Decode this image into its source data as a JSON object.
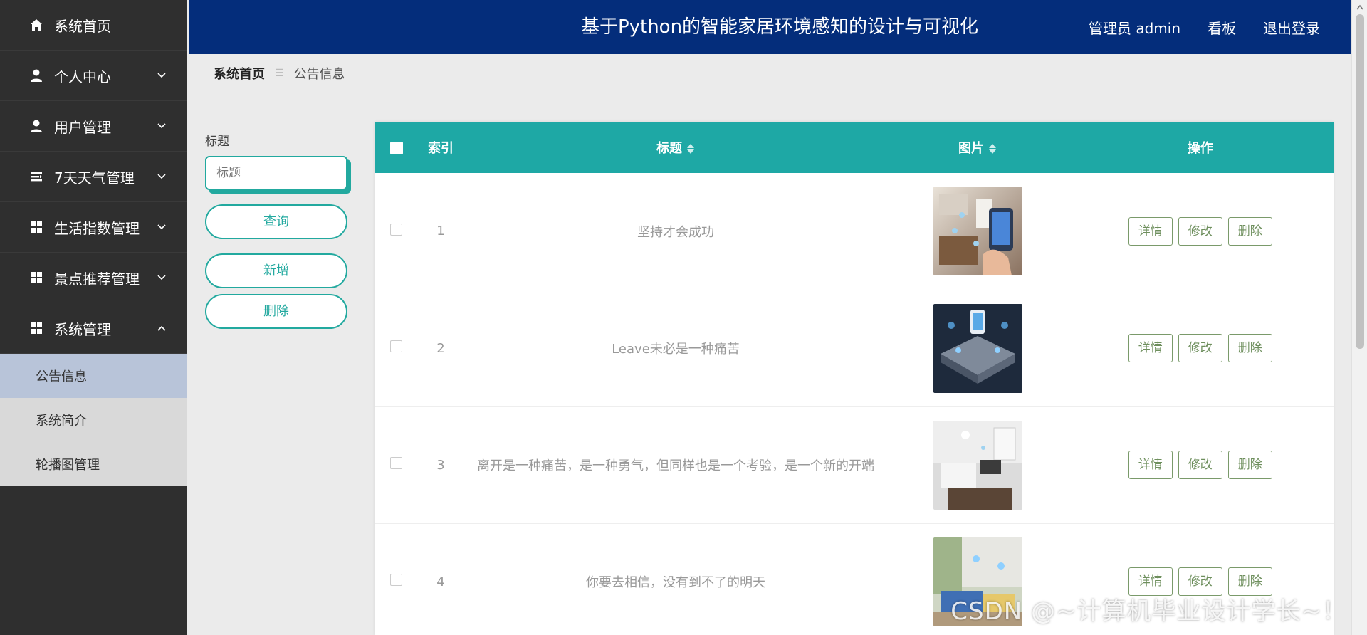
{
  "header": {
    "title": "基于Python的智能家居环境感知的设计与可视化",
    "admin_label": "管理员 admin",
    "board_label": "看板",
    "logout_label": "退出登录"
  },
  "sidebar": {
    "items": [
      {
        "label": "系统首页",
        "icon": "home-icon"
      },
      {
        "label": "个人中心",
        "icon": "user-icon"
      },
      {
        "label": "用户管理",
        "icon": "user-icon"
      },
      {
        "label": "7天天气管理",
        "icon": "list-icon"
      },
      {
        "label": "生活指数管理",
        "icon": "grid-icon"
      },
      {
        "label": "景点推荐管理",
        "icon": "grid-icon"
      },
      {
        "label": "系统管理",
        "icon": "grid-icon"
      }
    ],
    "submenu": [
      {
        "label": "公告信息",
        "active": true
      },
      {
        "label": "系统简介",
        "active": false
      },
      {
        "label": "轮播图管理",
        "active": false
      }
    ]
  },
  "breadcrumb": {
    "home": "系统首页",
    "current": "公告信息"
  },
  "search": {
    "label": "标题",
    "placeholder": "标题",
    "query_button": "查询",
    "add_button": "新增",
    "delete_button": "删除"
  },
  "table": {
    "headers": [
      "索引",
      "标题",
      "图片",
      "操作"
    ],
    "actions": {
      "detail": "详情",
      "edit": "修改",
      "delete": "删除"
    },
    "rows": [
      {
        "index": "1",
        "title": "坚持才会成功"
      },
      {
        "index": "2",
        "title": "Leave未必是一种痛苦"
      },
      {
        "index": "3",
        "title": "离开是一种痛苦，是一种勇气，但同样也是一个考验，是一个新的开端"
      },
      {
        "index": "4",
        "title": "你要去相信，没有到不了的明天"
      }
    ]
  },
  "watermark": "CSDN @~计算机毕业设计学长~！",
  "colors": {
    "sidebar_bg": "#2f2f2f",
    "topbar_bg": "#042d7b",
    "accent": "#1ea8a5",
    "submenu_active": "#b8c4d9"
  }
}
